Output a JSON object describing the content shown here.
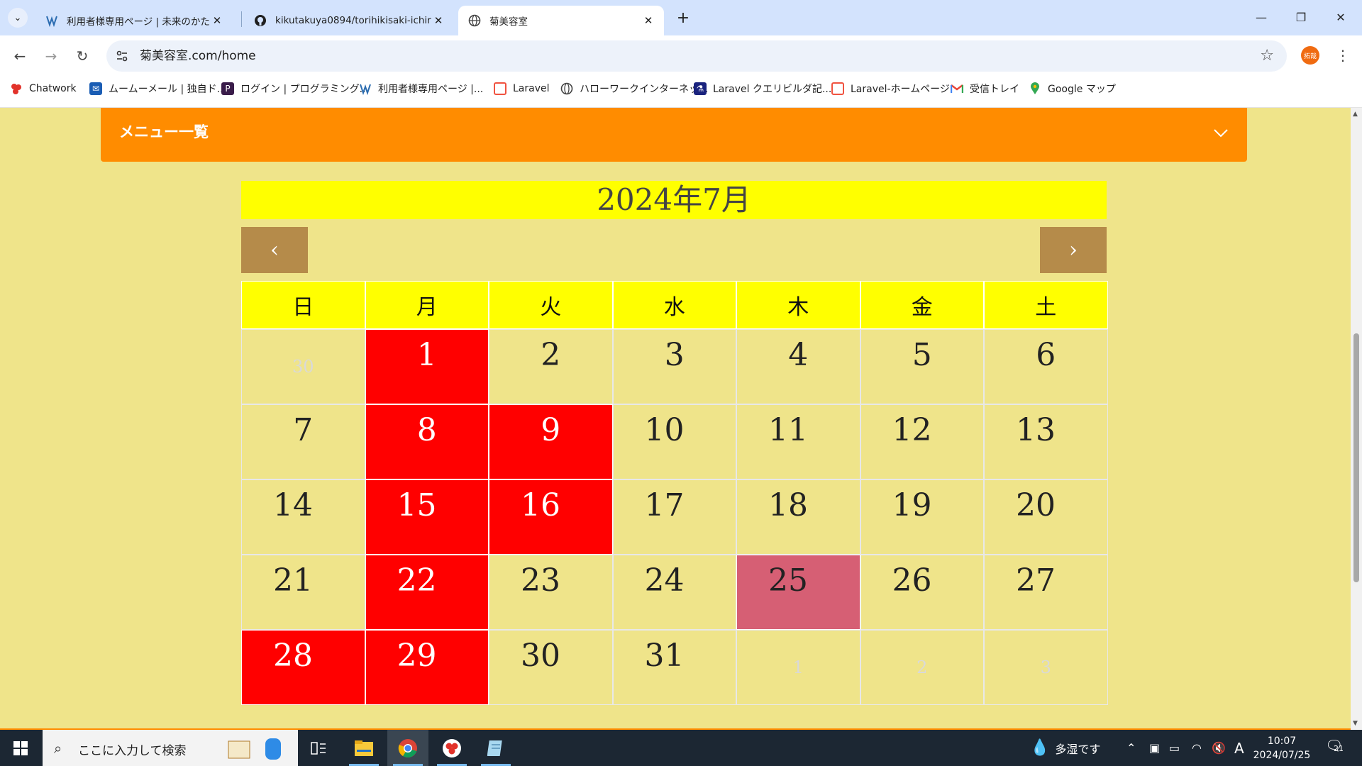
{
  "browser": {
    "tabs": [
      {
        "title": "利用者様専用ページ | 未来のかたち",
        "active": false
      },
      {
        "title": "kikutakuya0894/torihikisaki-ichiran",
        "active": false
      },
      {
        "title": "菊美容室",
        "active": true
      }
    ],
    "url": "菊美容室.com/home",
    "profile_label": "拓哉",
    "bookmarks": [
      "Chatwork",
      "ムームーメール | 独自ド...",
      "ログイン | プログラミング...",
      "利用者様専用ページ |...",
      "Laravel",
      "ハローワークインターネッ...",
      "Laravel クエリビルダ記...",
      "Laravel-ホームページ",
      "受信トレイ",
      "Google マップ"
    ]
  },
  "page": {
    "menu_title": "メニュー一覧",
    "month_title": "2024年7月",
    "prev_label": "‹",
    "next_label": "›",
    "weekdays": [
      "日",
      "月",
      "火",
      "水",
      "木",
      "金",
      "土"
    ],
    "weeks": [
      [
        {
          "d": "30",
          "type": "other"
        },
        {
          "d": "1",
          "type": "closed"
        },
        {
          "d": "2",
          "type": "normal"
        },
        {
          "d": "3",
          "type": "normal"
        },
        {
          "d": "4",
          "type": "normal"
        },
        {
          "d": "5",
          "type": "normal"
        },
        {
          "d": "6",
          "type": "normal"
        }
      ],
      [
        {
          "d": "7",
          "type": "normal"
        },
        {
          "d": "8",
          "type": "closed"
        },
        {
          "d": "9",
          "type": "closed"
        },
        {
          "d": "10",
          "type": "normal"
        },
        {
          "d": "11",
          "type": "normal"
        },
        {
          "d": "12",
          "type": "normal"
        },
        {
          "d": "13",
          "type": "normal"
        }
      ],
      [
        {
          "d": "14",
          "type": "normal"
        },
        {
          "d": "15",
          "type": "closed"
        },
        {
          "d": "16",
          "type": "closed"
        },
        {
          "d": "17",
          "type": "normal"
        },
        {
          "d": "18",
          "type": "normal"
        },
        {
          "d": "19",
          "type": "normal"
        },
        {
          "d": "20",
          "type": "normal"
        }
      ],
      [
        {
          "d": "21",
          "type": "normal"
        },
        {
          "d": "22",
          "type": "closed"
        },
        {
          "d": "23",
          "type": "normal"
        },
        {
          "d": "24",
          "type": "normal"
        },
        {
          "d": "25",
          "type": "today"
        },
        {
          "d": "26",
          "type": "normal"
        },
        {
          "d": "27",
          "type": "normal"
        }
      ],
      [
        {
          "d": "28",
          "type": "closed"
        },
        {
          "d": "29",
          "type": "closed"
        },
        {
          "d": "30",
          "type": "normal"
        },
        {
          "d": "31",
          "type": "normal"
        },
        {
          "d": "1",
          "type": "other"
        },
        {
          "d": "2",
          "type": "other"
        },
        {
          "d": "3",
          "type": "other"
        }
      ]
    ],
    "colors": {
      "page_bg": "#efe48a",
      "menu_bg": "#ff8c00",
      "header_bg": "#ffff00",
      "nav_button_bg": "#b58b4a",
      "closed_bg": "#ff0000",
      "today_bg": "#d65f74"
    }
  },
  "taskbar": {
    "search_placeholder": "ここに入力して検索",
    "weather": "多湿です",
    "ime": "A",
    "time": "10:07",
    "date": "2024/07/25",
    "notification_count": "21"
  }
}
